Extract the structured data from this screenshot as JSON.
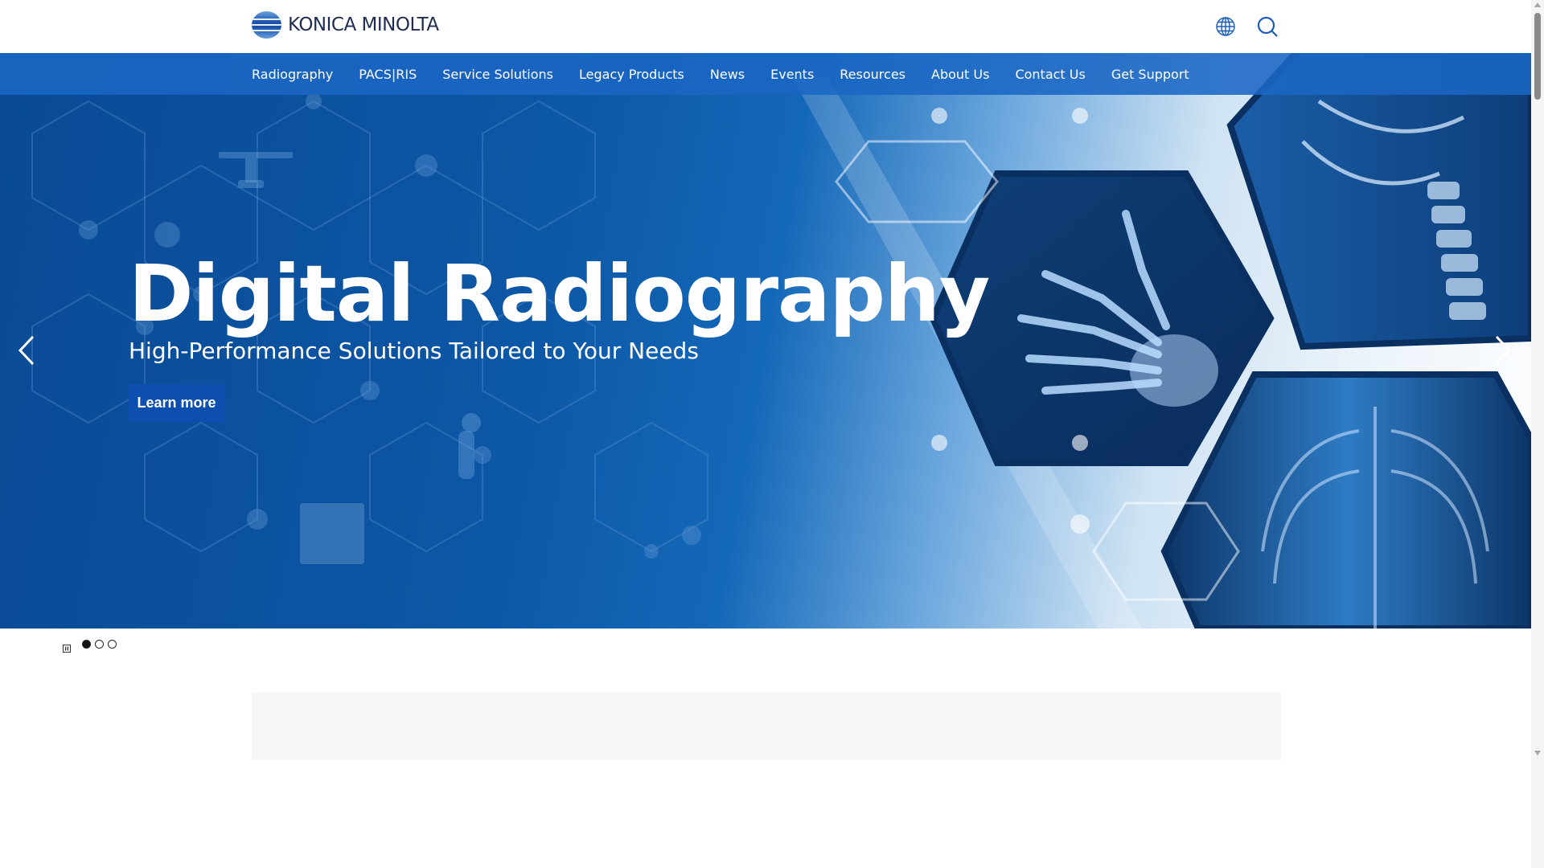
{
  "brand": {
    "name": "KONICA MINOLTA",
    "logo_icon": "konica-minolta-globe-logo"
  },
  "header": {
    "globe_icon": "globe-icon",
    "search_icon": "search-icon"
  },
  "nav": {
    "items": [
      {
        "label": "Radiography"
      },
      {
        "label": "PACS|RIS"
      },
      {
        "label": "Service Solutions"
      },
      {
        "label": "Legacy Products"
      },
      {
        "label": "News"
      },
      {
        "label": "Events"
      },
      {
        "label": "Resources"
      },
      {
        "label": "About Us"
      },
      {
        "label": "Contact Us"
      },
      {
        "label": "Get Support"
      }
    ]
  },
  "hero": {
    "title": "Digital Radiography",
    "subtitle": "High-Performance Solutions Tailored to Your Needs",
    "cta_label": "Learn more",
    "prev_icon": "chevron-left-icon",
    "next_icon": "chevron-right-icon"
  },
  "carousel": {
    "pause_icon": "pause-icon",
    "slide_count": 3,
    "active_index": 0
  },
  "colors": {
    "brand_blue": "#0c4fae",
    "nav_blue": "#1a66c4",
    "logo_text": "#1e2d4f"
  }
}
